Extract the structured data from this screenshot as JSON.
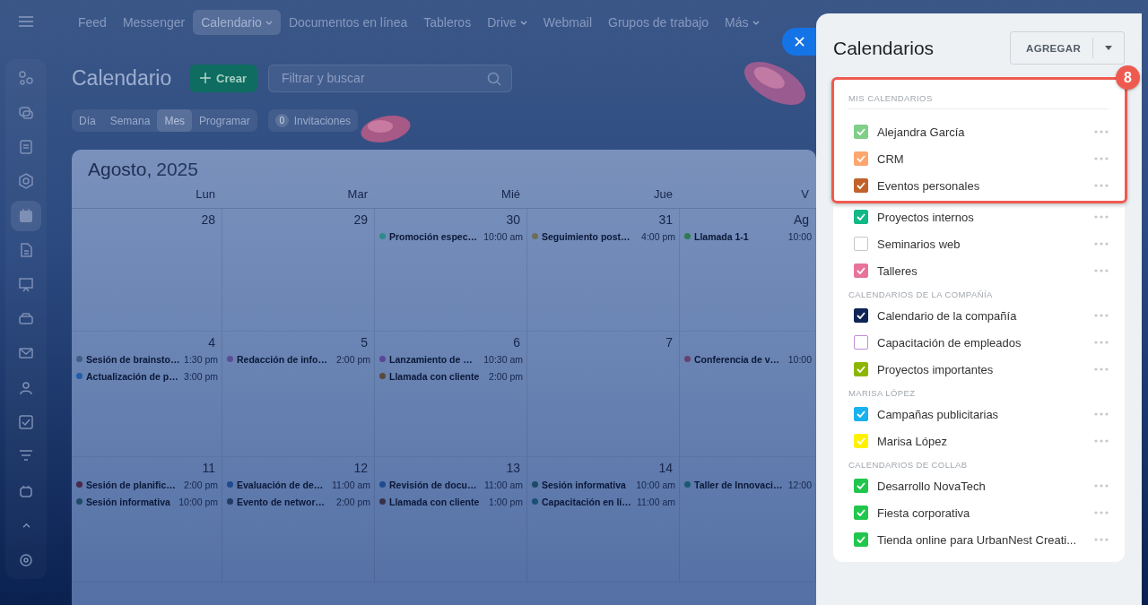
{
  "sidebar": {
    "items": [
      {
        "selected": false
      },
      {
        "selected": false
      },
      {
        "selected": false
      },
      {
        "selected": false
      },
      {
        "selected": true
      },
      {
        "selected": false
      },
      {
        "selected": false
      },
      {
        "selected": false
      },
      {
        "selected": false
      },
      {
        "selected": false
      },
      {
        "selected": false
      },
      {
        "selected": false
      },
      {
        "selected": false
      },
      {
        "selected": false
      },
      {
        "selected": false
      }
    ]
  },
  "nav": {
    "items": [
      {
        "label": "Feed",
        "selected": false,
        "has_menu": false
      },
      {
        "label": "Messenger",
        "selected": false,
        "has_menu": false
      },
      {
        "label": "Calendario",
        "selected": true,
        "has_menu": true
      },
      {
        "label": "Documentos en línea",
        "selected": false,
        "has_menu": false
      },
      {
        "label": "Tableros",
        "selected": false,
        "has_menu": false
      },
      {
        "label": "Drive",
        "selected": false,
        "has_menu": true
      },
      {
        "label": "Webmail",
        "selected": false,
        "has_menu": false
      },
      {
        "label": "Grupos de trabajo",
        "selected": false,
        "has_menu": false
      },
      {
        "label": "Más",
        "selected": false,
        "has_menu": true
      }
    ]
  },
  "toolbar": {
    "title": "Calendario",
    "create_button": "Crear",
    "search": {
      "placeholder": "Filtrar y buscar"
    },
    "views": [
      {
        "label": "Día",
        "selected": false
      },
      {
        "label": "Semana",
        "selected": false
      },
      {
        "label": "Mes",
        "selected": true
      },
      {
        "label": "Programar",
        "selected": false
      }
    ],
    "invitations": {
      "count": "0",
      "label": "Invitaciones"
    }
  },
  "calendar": {
    "month": "Agosto,",
    "year": "2025",
    "weekdays": [
      "Lun",
      "Mar",
      "Mié",
      "Jue",
      "V"
    ],
    "weeks": [
      [
        {
          "day": "28"
        },
        {
          "day": "29"
        },
        {
          "day": "30",
          "events": [
            {
              "title": "Promoción espec…",
              "time": "10:00 am",
              "color": "#2e8a8a"
            }
          ]
        },
        {
          "day": "31",
          "events": [
            {
              "title": "Seguimiento post…",
              "time": "4:00 pm",
              "color": "#6e6e5a"
            }
          ]
        },
        {
          "day": "Ag",
          "events": [
            {
              "title": "Llamada 1-1",
              "time": "10:00",
              "color": "#2f7a4e"
            }
          ]
        }
      ],
      [
        {
          "day": "4",
          "events": [
            {
              "title": "Sesión de brainsto…",
              "time": "1:30 pm",
              "color": "#3f5f86"
            },
            {
              "title": "Actualización de p…",
              "time": "3:00 pm",
              "color": "#1e5fa8"
            }
          ]
        },
        {
          "day": "5",
          "events": [
            {
              "title": "Redacción de info…",
              "time": "2:00 pm",
              "color": "#5a4f96"
            }
          ]
        },
        {
          "day": "6",
          "events": [
            {
              "title": "Lanzamiento de …",
              "time": "10:30 am",
              "color": "#5a4696"
            },
            {
              "title": "Llamada con cliente",
              "time": "2:00 pm",
              "color": "#5a4a3a"
            }
          ]
        },
        {
          "day": "7"
        },
        {
          "events": [
            {
              "title": "Conferencia de v…",
              "time": "10:00",
              "color": "#6a4070"
            }
          ]
        }
      ],
      [
        {
          "day": "11",
          "events": [
            {
              "title": "Sesión de planific…",
              "time": "2:00 pm",
              "color": "#4a2848"
            },
            {
              "title": "Sesión informativa",
              "time": "10:00 pm",
              "color": "#1e4a68"
            }
          ]
        },
        {
          "day": "12",
          "events": [
            {
              "title": "Evaluación de de…",
              "time": "11:00 am",
              "color": "#1e4a90"
            },
            {
              "title": "Evento de networ…",
              "time": "2:00 pm",
              "color": "#243a68"
            }
          ]
        },
        {
          "day": "13",
          "events": [
            {
              "title": "Revisión de docu…",
              "time": "11:00 am",
              "color": "#1e4a90"
            },
            {
              "title": "Llamada con cliente",
              "time": "1:00 pm",
              "color": "#3a3048"
            }
          ]
        },
        {
          "day": "14",
          "events": [
            {
              "title": "Sesión informativa",
              "time": "10:00 am",
              "color": "#1e4a68"
            },
            {
              "title": "Capacitación en lí…",
              "time": "11:00 am",
              "color": "#1a5078"
            }
          ]
        },
        {
          "events": [
            {
              "title": "Taller de Innovaci…",
              "time": "12:00",
              "color": "#1a5a70"
            }
          ]
        }
      ]
    ]
  },
  "panel": {
    "title": "Calendarios",
    "add_button": "AGREGAR",
    "highlight_badge": "8",
    "sections": [
      {
        "heading": "MIS CALENDARIOS",
        "highlighted_items": [
          {
            "label": "Alejandra García",
            "checked": true,
            "color": "#7fcf88"
          },
          {
            "label": "CRM",
            "checked": true,
            "color": "#fda66e"
          },
          {
            "label": "Eventos personales",
            "checked": true,
            "color": "#c0622a"
          }
        ],
        "items": [
          {
            "label": "Proyectos internos",
            "checked": true,
            "color": "#12b886"
          },
          {
            "label": "Seminarios web",
            "checked": false,
            "color": "#c4c8cc"
          },
          {
            "label": "Talleres",
            "checked": true,
            "color": "#e8739a"
          }
        ]
      },
      {
        "heading": "CALENDARIOS DE LA COMPAÑÍA",
        "items": [
          {
            "label": "Calendario de la compañía",
            "checked": true,
            "color": "#0f2556"
          },
          {
            "label": "Capacitación de empleados",
            "checked": false,
            "color": "#c18cd8"
          },
          {
            "label": "Proyectos importantes",
            "checked": true,
            "color": "#8db600"
          }
        ]
      },
      {
        "heading": "MARISA LÓPEZ",
        "items": [
          {
            "label": "Campañas publicitarias",
            "checked": true,
            "color": "#1ab1f0"
          },
          {
            "label": "Marisa López",
            "checked": true,
            "color": "#fff200"
          }
        ]
      },
      {
        "heading": "CALENDARIOS DE COLLAB",
        "items": [
          {
            "label": "Desarrollo NovaTech",
            "checked": true,
            "color": "#21c74d"
          },
          {
            "label": "Fiesta corporativa",
            "checked": true,
            "color": "#21c74d"
          },
          {
            "label": "Tienda online para UrbanNest Creati...",
            "checked": true,
            "color": "#21c74d"
          }
        ]
      }
    ]
  }
}
